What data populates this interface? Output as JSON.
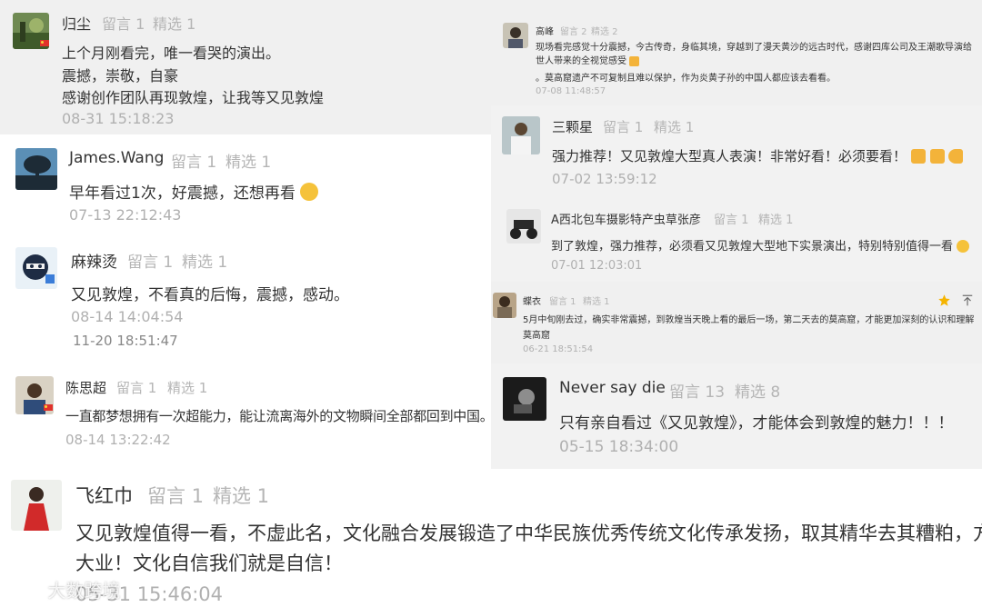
{
  "left_panel": {
    "comments": [
      {
        "name": "归尘",
        "tags": [
          "留言 1",
          "精选 1"
        ],
        "lines": [
          "上个月刚看完，唯一看哭的演出。",
          "震撼，崇敬，自豪",
          "感谢创作团队再现敦煌，让我等又见敦煌"
        ],
        "time": "08-31 15:18:23"
      },
      {
        "name": "James.Wang",
        "tags": [
          "留言 1",
          "精选 1"
        ],
        "lines": [
          "早年看过1次，好震撼，还想再看"
        ],
        "time": "07-13 22:12:43"
      },
      {
        "name": "麻辣烫",
        "tags": [
          "留言 1",
          "精选 1"
        ],
        "lines": [
          "又见敦煌，不看真的后悔，震撼，感动。"
        ],
        "time": "08-14 14:04:54",
        "time2": "11-20 18:51:47"
      },
      {
        "name": "陈思超",
        "tags": [
          "留言 1",
          "精选 1"
        ],
        "lines": [
          "一直都梦想拥有一次超能力，能让流离海外的文物瞬间全部都回到中国。"
        ],
        "time": "08-14 13:22:42"
      }
    ]
  },
  "right_panel": {
    "comments": [
      {
        "name": "高峰",
        "tags": [
          "留言 2",
          "精选 2"
        ],
        "lines": [
          "现场看完感觉十分震撼，今古传奇，身临其境，穿越到了漫天黄沙的远古时代，感谢四库公司及王潮歌导演给世人带来的全视觉感受",
          "。莫高窟遗产不可复制且难以保护，作为炎黄子孙的中国人都应该去看看。"
        ],
        "time": "07-08 11:48:57"
      },
      {
        "name": "三颗星",
        "tags": [
          "留言 1",
          "精选 1"
        ],
        "lines": [
          "强力推荐！又见敦煌大型真人表演！非常好看！必须要看！"
        ],
        "time": "07-02 13:59:12"
      },
      {
        "name": "A西北包车摄影特产虫草张彦",
        "tags": [
          "留言 1",
          "精选 1"
        ],
        "lines": [
          "到了敦煌，强力推荐，必须看又见敦煌大型地下实景演出，特别特别值得一看"
        ],
        "time": "07-01 12:03:01"
      },
      {
        "name": "蝶衣",
        "tags": [
          "留言 1",
          "精选 1"
        ],
        "lines": [
          "5月中旬刚去过，确实非常震撼，到敦煌当天晚上看的最后一场，第二天去的莫高窟，才能更加深刻的认识和理解",
          "莫高窟"
        ],
        "time": "06-21 18:51:54"
      },
      {
        "name": "Never say die",
        "tags": [
          "留言 13",
          "精选 8"
        ],
        "lines": [
          "只有亲自看过《又见敦煌》，才能体会到敦煌的魅力！！！"
        ],
        "time": "05-15 18:34:00"
      }
    ]
  },
  "bottom_panel": {
    "name": "飞红巾",
    "tags": [
      "留言 1",
      "精选 1"
    ],
    "lines": [
      "又见敦煌值得一看，不虚此名，文化融合发展锻造了中华民族优秀传统文化传承发扬，取其精华去其糟粕，方成",
      "大业！文化自信我们就是自信！"
    ],
    "time": "05-31 15:46:04"
  },
  "watermark": "大数跨境",
  "icons": {
    "star": "star-icon",
    "pin": "pin-top-icon"
  },
  "colors": {
    "gray_panel": "#f0f0f0",
    "meta_gray": "#b5b5b5",
    "flag_red": "#e0322b",
    "star_yellow": "#f5b400"
  }
}
